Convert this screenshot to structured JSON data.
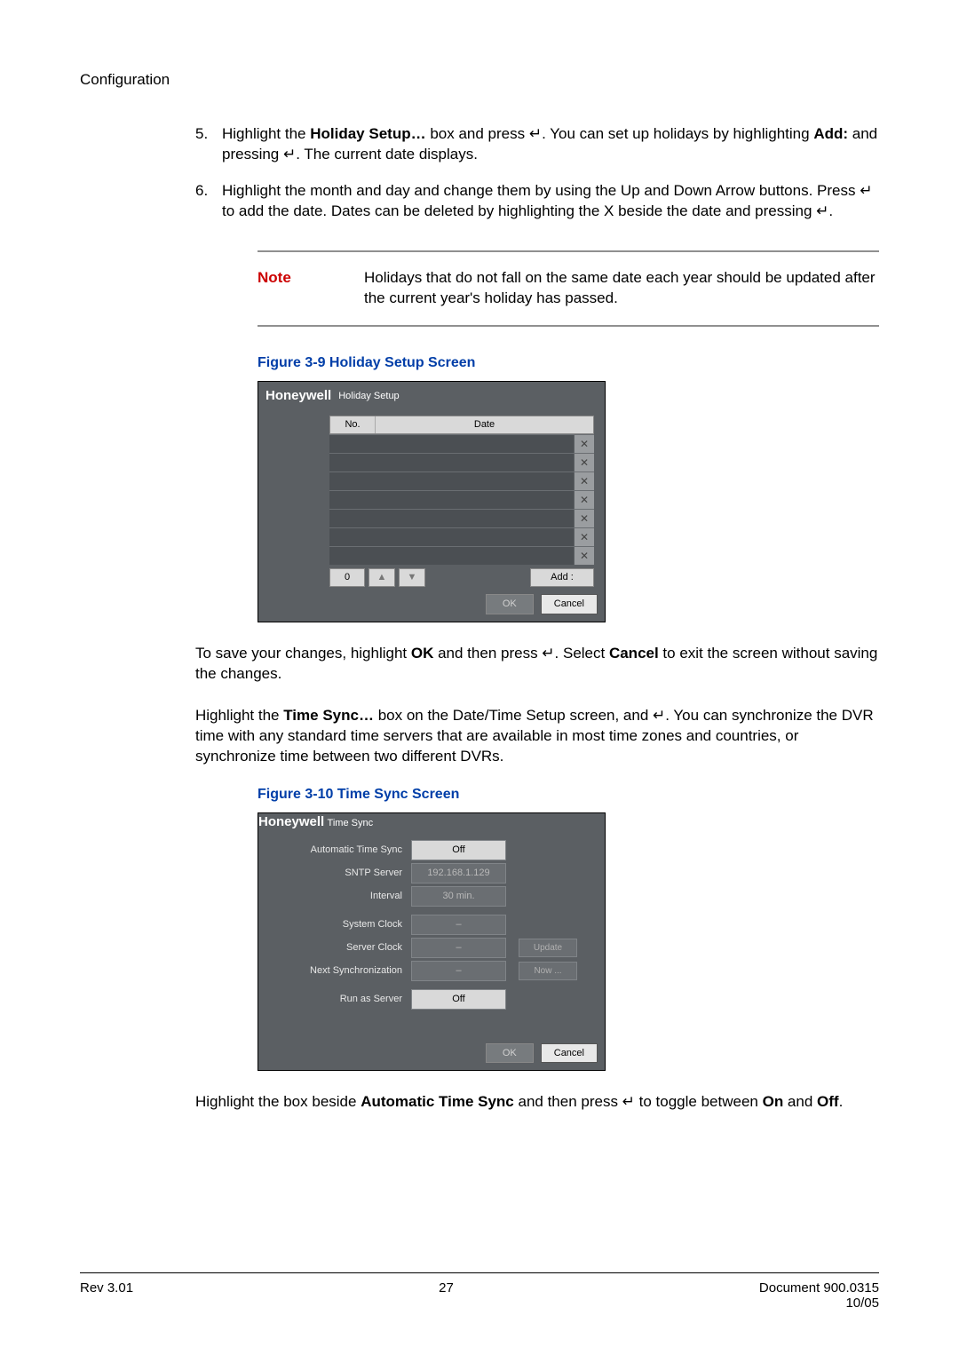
{
  "header": "Configuration",
  "step5": {
    "num": "5.",
    "p1a": "Highlight the ",
    "p1b": "Holiday Setup…",
    "p1c": " box and press ↵. You can set up holidays by highlighting ",
    "p1d": "Add:",
    "p1e": " and pressing ↵. The current date displays."
  },
  "step6": {
    "num": "6.",
    "text": "Highlight the month and day and change them by using the Up and Down Arrow buttons. Press ↵ to add the date. Dates can be deleted by highlighting the X beside the date and pressing ↵."
  },
  "note": {
    "label": "Note",
    "text": "Holidays that do not fall on the same date each year should be updated after the current year's holiday has passed."
  },
  "fig39": "Figure 3-9        Holiday Setup Screen",
  "holiday": {
    "brand": "Honeywell",
    "title": "Holiday Setup",
    "col_no": "No.",
    "col_date": "Date",
    "count": "0",
    "up": "▲",
    "down": "▼",
    "add": "Add :",
    "ok": "OK",
    "cancel": "Cancel"
  },
  "para1a": "To save your changes, highlight ",
  "para1b": "OK",
  "para1c": " and then press ↵. Select ",
  "para1d": "Cancel",
  "para1e": " to exit the screen without saving the changes.",
  "para2a": "Highlight the ",
  "para2b": "Time Sync…",
  "para2c": " box on the Date/Time Setup screen, and ↵. You can synchronize the DVR time with any standard time servers that are available in most time zones and countries, or synchronize time between two different DVRs.",
  "fig310": "Figure 3-10      Time Sync Screen",
  "timesync": {
    "brand": "Honeywell",
    "title": "Time Sync",
    "rows": {
      "auto_lbl": "Automatic Time Sync",
      "auto_val": "Off",
      "sntp_lbl": "SNTP Server",
      "sntp_val": "192.168.1.129",
      "int_lbl": "Interval",
      "int_val": "30 min.",
      "sys_lbl": "System Clock",
      "sys_val": "–",
      "srv_lbl": "Server Clock",
      "srv_val": "–",
      "update": "Update",
      "next_lbl": "Next Synchronization",
      "next_val": "–",
      "now": "Now ...",
      "run_lbl": "Run as Server",
      "run_val": "Off"
    },
    "ok": "OK",
    "cancel": "Cancel"
  },
  "para3a": "Highlight the box beside ",
  "para3b": "Automatic Time Sync",
  "para3c": " and then press ↵ to toggle between ",
  "para3d": "On",
  "para3e": " and ",
  "para3f": "Off",
  "para3g": ".",
  "footer": {
    "rev": "Rev 3.01",
    "page": "27",
    "doc": "Document 900.0315",
    "date": "10/05"
  }
}
